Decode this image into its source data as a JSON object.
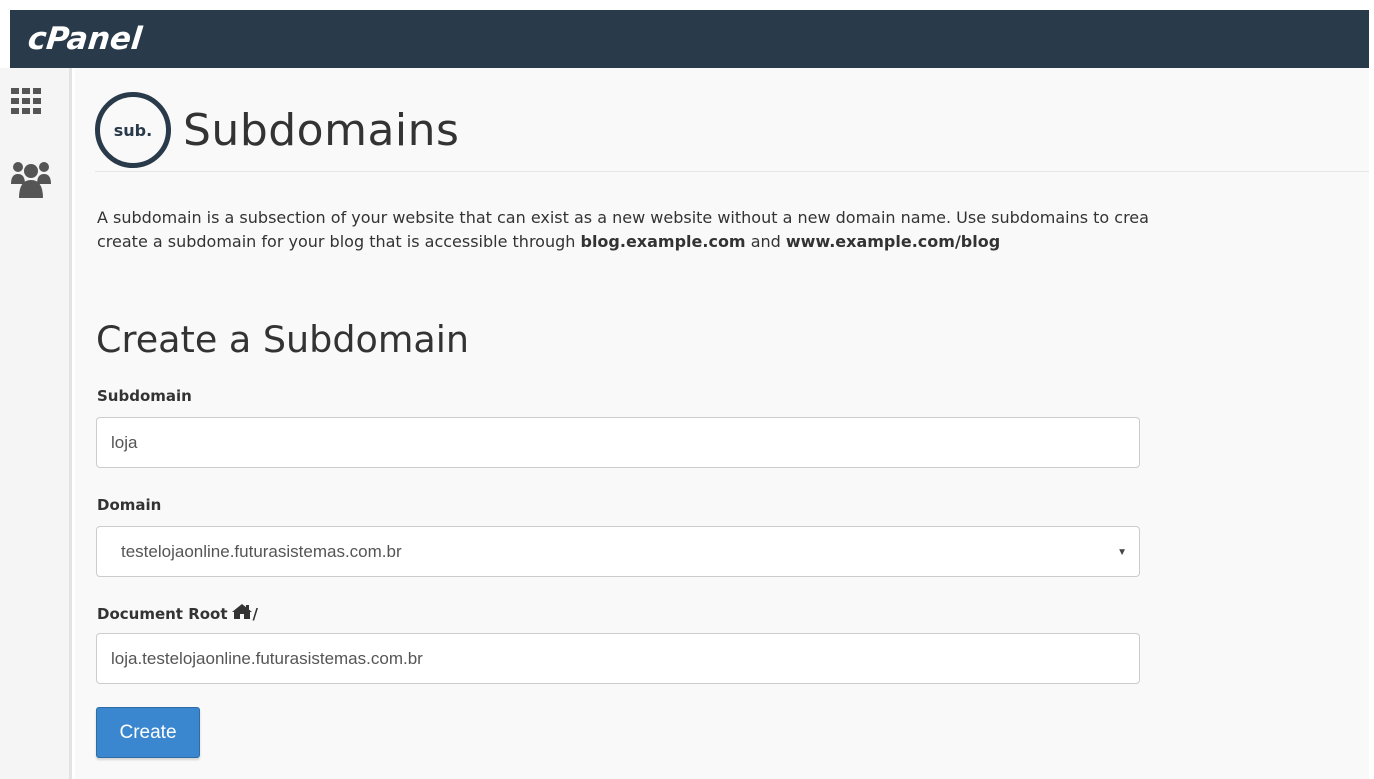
{
  "brand": {
    "logo_text": "cPanel",
    "topbar_color": "#293a4a"
  },
  "sidebar": {
    "items": [
      {
        "icon": "grid-icon"
      },
      {
        "icon": "users-icon"
      }
    ]
  },
  "header": {
    "logo_text": "sub.",
    "title": "Subdomains"
  },
  "description": {
    "part1": "A subdomain is a subsection of your website that can exist as a new website without a new domain name. Use subdomains to crea",
    "part2": "create a subdomain for your blog that is accessible through ",
    "bold1": "blog.example.com",
    "and": " and ",
    "bold2": "www.example.com/blog"
  },
  "form": {
    "section_title": "Create a Subdomain",
    "subdomain_label": "Subdomain",
    "subdomain_value": "loja",
    "domain_label": "Domain",
    "domain_value": "testelojaonline.futurasistemas.com.br",
    "document_root_label": "Document Root",
    "document_root_slash": "/",
    "document_root_value": "loja.testelojaonline.futurasistemas.com.br",
    "create_label": "Create",
    "button_color": "#3a86cf"
  }
}
